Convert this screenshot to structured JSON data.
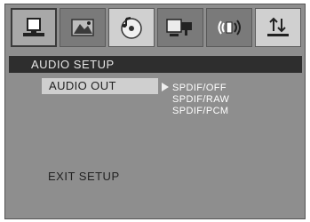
{
  "tabs": [
    {
      "icon": "general-setup-icon"
    },
    {
      "icon": "video-setup-icon"
    },
    {
      "icon": "audio-disc-icon"
    },
    {
      "icon": "preference-icon"
    },
    {
      "icon": "speaker-icon"
    },
    {
      "icon": "audio-output-icon"
    }
  ],
  "header": {
    "title": "AUDIO  SETUP"
  },
  "menu": {
    "selected_item": "AUDIO OUT",
    "options": [
      "SPDIF/OFF",
      "SPDIF/RAW",
      "SPDIF/PCM"
    ]
  },
  "footer": {
    "exit_label": "EXIT SETUP"
  },
  "colors": {
    "frame": "#8e8e8e",
    "header_bar": "#2e2e2e",
    "highlight": "#cfcfcf",
    "option_text": "#ffffff"
  }
}
